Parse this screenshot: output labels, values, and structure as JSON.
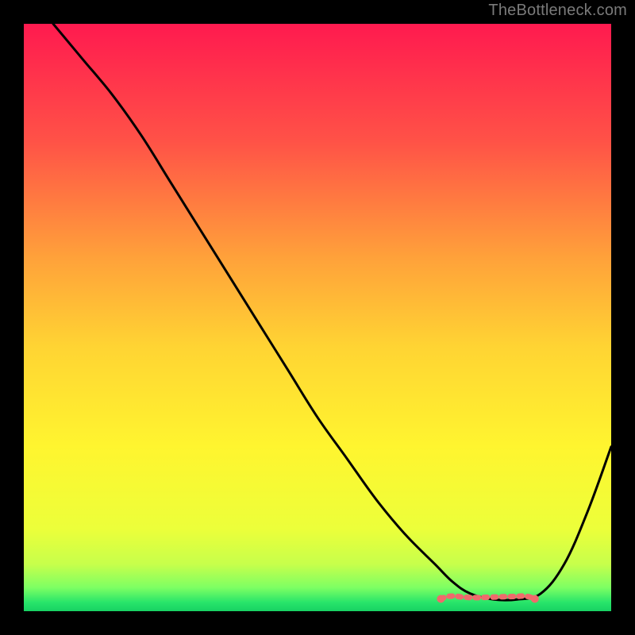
{
  "attribution": "TheBottleneck.com",
  "colors": {
    "page_bg": "#000000",
    "attribution_text": "#7a7a7a",
    "curve_stroke": "#000000",
    "accent_stroke": "#ef6a6c",
    "gradient_stops": [
      {
        "offset": 0.0,
        "color": "#ff1a4f"
      },
      {
        "offset": 0.2,
        "color": "#ff5247"
      },
      {
        "offset": 0.4,
        "color": "#ffa23a"
      },
      {
        "offset": 0.55,
        "color": "#ffd433"
      },
      {
        "offset": 0.72,
        "color": "#fff52f"
      },
      {
        "offset": 0.86,
        "color": "#ecff3a"
      },
      {
        "offset": 0.92,
        "color": "#c7ff4b"
      },
      {
        "offset": 0.96,
        "color": "#7dff63"
      },
      {
        "offset": 0.985,
        "color": "#28e56a"
      },
      {
        "offset": 1.0,
        "color": "#18d263"
      }
    ]
  },
  "chart_data": {
    "type": "line",
    "title": "",
    "xlabel": "",
    "ylabel": "",
    "xlim": [
      0,
      100
    ],
    "ylim": [
      0,
      100
    ],
    "grid": false,
    "series": [
      {
        "name": "bottleneck-curve",
        "x": [
          5,
          10,
          15,
          20,
          25,
          30,
          35,
          40,
          45,
          50,
          55,
          60,
          65,
          70,
          73,
          76,
          80,
          84,
          88,
          92,
          96,
          100
        ],
        "values": [
          100,
          94,
          88,
          81,
          73,
          65,
          57,
          49,
          41,
          33,
          26,
          19,
          13,
          8,
          5,
          3,
          2,
          2,
          3,
          8,
          17,
          28
        ]
      }
    ],
    "highlight": {
      "name": "optimal-zone",
      "x_start": 71,
      "x_end": 87,
      "y_approx": 2.5
    }
  }
}
